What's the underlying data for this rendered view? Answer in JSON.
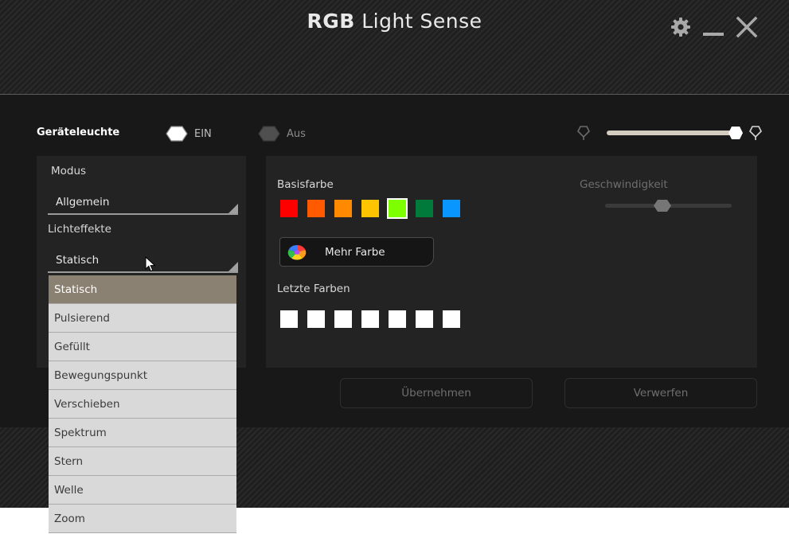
{
  "window": {
    "title_bold": "RGB",
    "title_rest": "Light Sense",
    "buttons": [
      "gear-icon",
      "minimize-icon",
      "close-icon"
    ]
  },
  "device_light": {
    "label": "Geräteleuchte",
    "on_label": "EIN",
    "off_label": "Aus",
    "state": "EIN"
  },
  "brightness": {
    "level": 0.95
  },
  "modus": {
    "label": "Modus",
    "value": "Allgemein"
  },
  "effects": {
    "label": "Lichteffekte",
    "value": "Statisch",
    "options": [
      "Statisch",
      "Pulsierend",
      "Gefüllt",
      "Bewegungspunkt",
      "Verschieben",
      "Spektrum",
      "Stern",
      "Welle",
      "Zoom"
    ]
  },
  "base_color": {
    "label": "Basisfarbe",
    "swatches": [
      "#ff0000",
      "#ff5a00",
      "#ff8a00",
      "#ffc400",
      "#7dff00",
      "#007a3a",
      "#0a96ff"
    ],
    "selected_index": 4
  },
  "more_color": {
    "label": "Mehr Farbe"
  },
  "recent_colors": {
    "label": "Letzte Farben",
    "swatches": [
      "#ffffff",
      "#ffffff",
      "#ffffff",
      "#ffffff",
      "#ffffff",
      "#ffffff",
      "#ffffff"
    ]
  },
  "speed": {
    "label": "Geschwindigkeit",
    "level": 0.45
  },
  "actions": {
    "apply": "Übernehmen",
    "discard": "Verwerfen"
  }
}
